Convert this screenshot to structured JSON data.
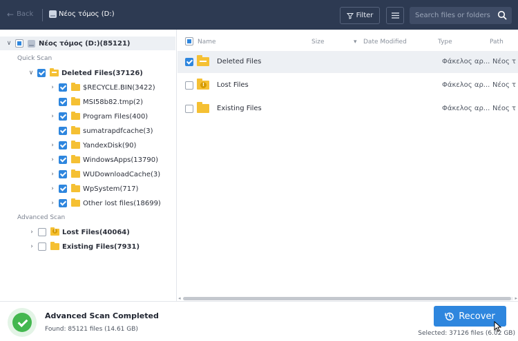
{
  "topbar": {
    "back_label": "Back",
    "breadcrumb": "Νέος τόμος (D:)",
    "filter_label": "Filter",
    "search_placeholder": "Search files or folders"
  },
  "tree": {
    "root_label": "Νέος τόμος (D:)(85121)",
    "quick_scan_label": "Quick Scan",
    "deleted_files_label": "Deleted Files(37126)",
    "children": [
      "$RECYCLE.BIN(3422)",
      "MSI58b82.tmp(2)",
      "Program Files(400)",
      "sumatrapdfcache(3)",
      "YandexDisk(90)",
      "WindowsApps(13790)",
      "WUDownloadCache(3)",
      "WpSystem(717)",
      "Other lost files(18699)"
    ],
    "advanced_scan_label": "Advanced Scan",
    "lost_files_label": "Lost Files(40064)",
    "existing_files_label": "Existing Files(7931)"
  },
  "list": {
    "columns": {
      "name": "Name",
      "size": "Size",
      "date": "Date Modified",
      "type": "Type",
      "path": "Path"
    },
    "rows": [
      {
        "name": "Deleted Files",
        "type": "Φάκελος αρ...",
        "path": "Νέος τ"
      },
      {
        "name": "Lost Files",
        "type": "Φάκελος αρ...",
        "path": "Νέος τ"
      },
      {
        "name": "Existing Files",
        "type": "Φάκελος αρ...",
        "path": "Νέος τ"
      }
    ]
  },
  "status": {
    "title": "Advanced Scan Completed",
    "found": "Found: 85121 files (14.61 GB)",
    "recover_label": "Recover",
    "selected": "Selected: 37126 files (6.02 GB)"
  },
  "colors": {
    "topbar_bg": "#2d3a52",
    "accent": "#2e86de",
    "folder": "#f5c033",
    "success": "#43b74f"
  }
}
